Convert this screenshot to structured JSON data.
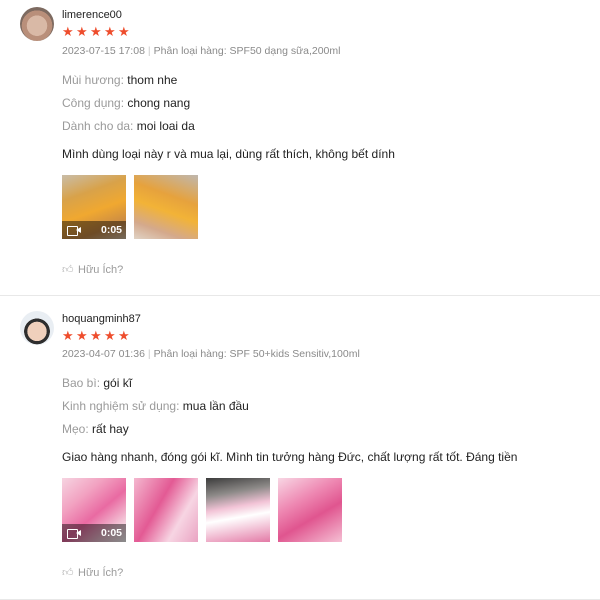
{
  "reviews": [
    {
      "username": "limerence00",
      "stars": 5,
      "date": "2023-07-15 17:08",
      "variant_label": "Phân loại hàng: SPF50 dạng sữa,200ml",
      "attributes": [
        {
          "key": "Mùi hương:",
          "value": "thom nhe"
        },
        {
          "key": "Công dụng:",
          "value": "chong nang"
        },
        {
          "key": "Dành cho da:",
          "value": "moi loai da"
        }
      ],
      "comment": "Mình dùng loại này r và mua lại, dùng rất thích, không bết dính",
      "video_duration": "0:05",
      "helpful_label": "Hữu Ích?"
    },
    {
      "username": "hoquangminh87",
      "stars": 5,
      "date": "2023-04-07 01:36",
      "variant_label": "Phân loại hàng: SPF 50+kids Sensitiv,100ml",
      "attributes": [
        {
          "key": "Bao bì:",
          "value": "gói kĩ"
        },
        {
          "key": "Kinh nghiệm sử dụng:",
          "value": "mua lần đầu"
        },
        {
          "key": "Mẹo:",
          "value": "rất hay"
        }
      ],
      "comment": "Giao hàng nhanh, đóng gói kĩ. Mình tin tưởng hàng Đức, chất lượng rất tốt. Đáng tiền",
      "video_duration": "0:05",
      "helpful_label": "Hữu Ích?"
    }
  ],
  "separator": "|",
  "icons": {
    "star": "star-icon",
    "video": "video-camera-icon",
    "helpful": "thumbs-up-icon"
  },
  "colors": {
    "star": "#ee4d2d",
    "muted_text": "#8a8a8a"
  }
}
